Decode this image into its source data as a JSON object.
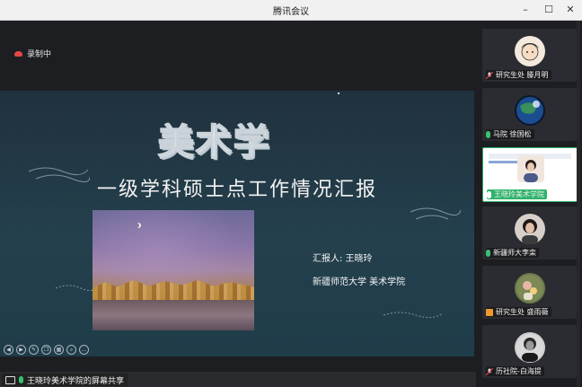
{
  "window": {
    "title": "腾讯会议"
  },
  "recording": {
    "label": "录制中"
  },
  "slide": {
    "headline": "美术学",
    "subtitle": "一级学科硕士点工作情况汇报",
    "reporter": "汇报人: 王晓玲",
    "affiliation": "新疆师范大学 美术学院"
  },
  "share": {
    "label": "王晓玲美术学院的屏幕共享"
  },
  "participants": [
    {
      "name": "研究生处 滕月明",
      "mic": "muted",
      "avatar_bg": "#f3e9dc"
    },
    {
      "name": "马院 徐国松",
      "mic": "on",
      "avatar_bg": "#0b1730"
    },
    {
      "name": "王晓玲美术学院",
      "mic": "on",
      "avatar_bg": "#ffffff",
      "active": true
    },
    {
      "name": "新疆师大李栾",
      "mic": "on",
      "avatar_bg": "#d7cfc9"
    },
    {
      "name": "研究生处 盛雨薇",
      "mic": "muted",
      "avatar_bg": "#6e7a4c"
    },
    {
      "name": "历社院-白海提",
      "mic": "muted",
      "avatar_bg": "#cfcfcf"
    }
  ],
  "colors": {
    "accent": "#2fb36b",
    "recording": "#e64545"
  }
}
